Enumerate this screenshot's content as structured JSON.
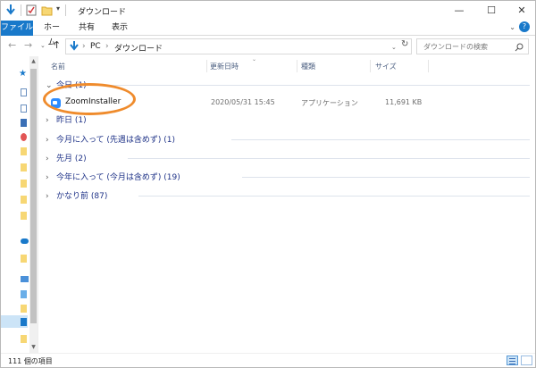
{
  "window": {
    "title": "ダウンロード"
  },
  "ribbon": {
    "tabs": [
      "ファイル",
      "ホーム",
      "共有",
      "表示"
    ]
  },
  "address": {
    "segments": [
      "PC",
      "ダウンロード"
    ]
  },
  "search": {
    "placeholder": "ダウンロードの検索"
  },
  "columns": {
    "name": "名前",
    "date": "更新日時",
    "type": "種類",
    "size": "サイズ"
  },
  "groups": [
    {
      "label": "今日 (1)",
      "expanded": true
    },
    {
      "label": "昨日 (1)",
      "expanded": false
    },
    {
      "label": "今月に入って (先週は含めず) (1)",
      "expanded": false
    },
    {
      "label": "先月 (2)",
      "expanded": false
    },
    {
      "label": "今年に入って (今月は含めず) (19)",
      "expanded": false
    },
    {
      "label": "かなり前 (87)",
      "expanded": false
    }
  ],
  "file": {
    "name": "ZoomInstaller",
    "date": "2020/05/31 15:45",
    "type": "アプリケーション",
    "size": "11,691 KB",
    "icon": "zoom-app-icon"
  },
  "status": {
    "count": "111 個の項目"
  },
  "colors": {
    "accent": "#1979ca",
    "highlight": "#ef8b2c",
    "group_text": "#1e3287",
    "zoom_blue": "#2d8cff"
  }
}
